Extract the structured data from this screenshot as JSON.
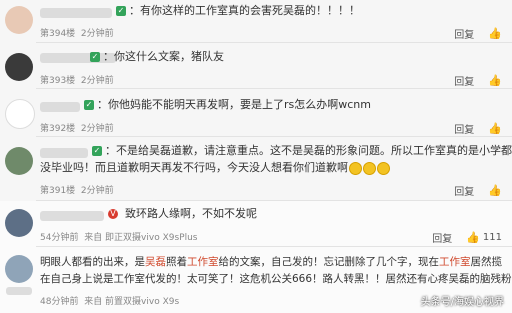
{
  "comments": [
    {
      "text": "：有你这样的工作室真的会害死吴磊的！！！！",
      "floor": "第394楼",
      "time": "2分钟前",
      "reply": "回复",
      "likes": ""
    },
    {
      "text": "：你这什么文案，猪队友",
      "floor": "第393楼",
      "time": "2分钟前",
      "reply": "回复",
      "likes": ""
    },
    {
      "text": "：你他妈能不能明天再发啊，要是上了rs怎么办啊wcnm",
      "floor": "第392楼",
      "time": "2分钟前",
      "reply": "回复",
      "likes": ""
    },
    {
      "line1": "：不是给吴磊道歉，请注意重点。这不是吴磊的形象问题。所以工作室真的是小学都还",
      "line2": "没毕业吗！而且道歉明天再发不行吗，今天没人想看你们道歉啊",
      "floor": "第391楼",
      "time": "2分钟前",
      "reply": "回复",
      "likes": ""
    },
    {
      "text": "致环路人缘啊，不如不发呢",
      "time": "54分钟前",
      "source": "来自 即正双摄vivo X9sPlus",
      "reply": "回复",
      "likes": "111"
    },
    {
      "line1_a": "明眼人都看的出来，是",
      "line1_b": "吴磊",
      "line1_c": "照着",
      "line1_d": "工作室",
      "line1_e": "给的文案，自己发的！忘记删除了几个字，现在",
      "line1_f": "工作室",
      "line1_g": "居然揽",
      "line2": "在自己身上说是工作室代发的！太可笑了！这危机公关666！路人转黑！！居然还有心疼吴磊的脑残粉",
      "time": "48分钟前",
      "source": "来自 前置双摄vivo X9s",
      "reply": "回复",
      "likes": ""
    }
  ],
  "watermark": "头条号/海娱心视界",
  "colors": {
    "green": "#33a35a",
    "red": "#d04a2e"
  },
  "icons": {
    "like": "thumb-up-icon",
    "verify": "green-badge-icon",
    "vip": "red-v-icon"
  }
}
